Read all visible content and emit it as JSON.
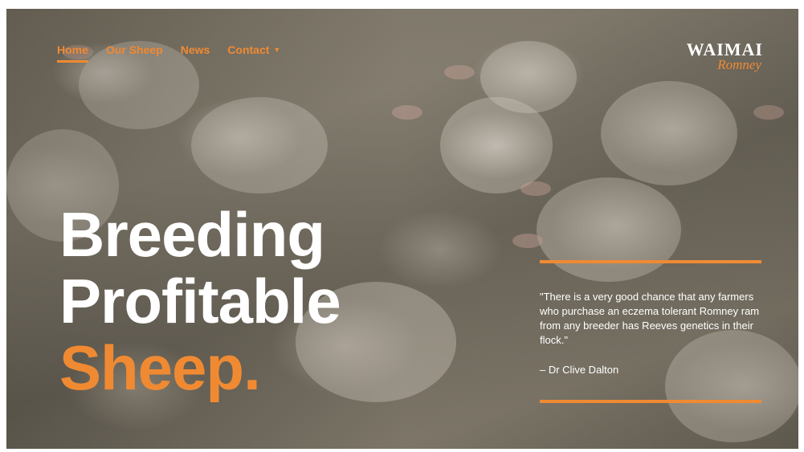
{
  "nav": {
    "items": [
      {
        "label": "Home",
        "active": true
      },
      {
        "label": "Our Sheep",
        "active": false
      },
      {
        "label": "News",
        "active": false
      },
      {
        "label": "Contact",
        "active": false,
        "has_dropdown": true
      }
    ],
    "dropdown_icon": "chevron-down-icon"
  },
  "logo": {
    "line1": "WAIMAI",
    "line2": "Romney"
  },
  "hero": {
    "line1": "Breeding",
    "line2": "Profitable",
    "line3": "Sheep."
  },
  "quote": {
    "text": "\"There is a very good chance that any farmers who purchase an eczema tolerant Romney ram from any breeder has Reeves genetics in their flock.\"",
    "author": "– Dr Clive Dalton"
  },
  "colors": {
    "accent": "#f08a32",
    "text_light": "#ffffff"
  },
  "background": "sheep-flock-photo"
}
